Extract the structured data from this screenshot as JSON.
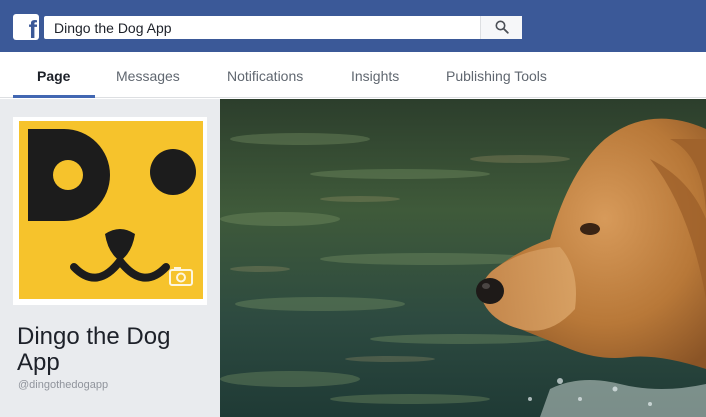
{
  "topbar": {
    "logo_letter": "f",
    "search_value": "Dingo the Dog App",
    "colors": {
      "brand": "#3b5998",
      "accent": "#4267b2",
      "avatar_bg": "#f6c32c"
    }
  },
  "tabs": [
    {
      "label": "Page",
      "active": true
    },
    {
      "label": "Messages"
    },
    {
      "label": "Notifications"
    },
    {
      "label": "Insights"
    },
    {
      "label": "Publishing Tools"
    }
  ],
  "profile": {
    "name": "Dingo the Dog App",
    "handle": "@dingothedogapp",
    "avatar_icon": "dog-face-logo",
    "camera_icon": "camera-icon"
  },
  "cover": {
    "image": "golden-retriever-in-water-photo"
  }
}
